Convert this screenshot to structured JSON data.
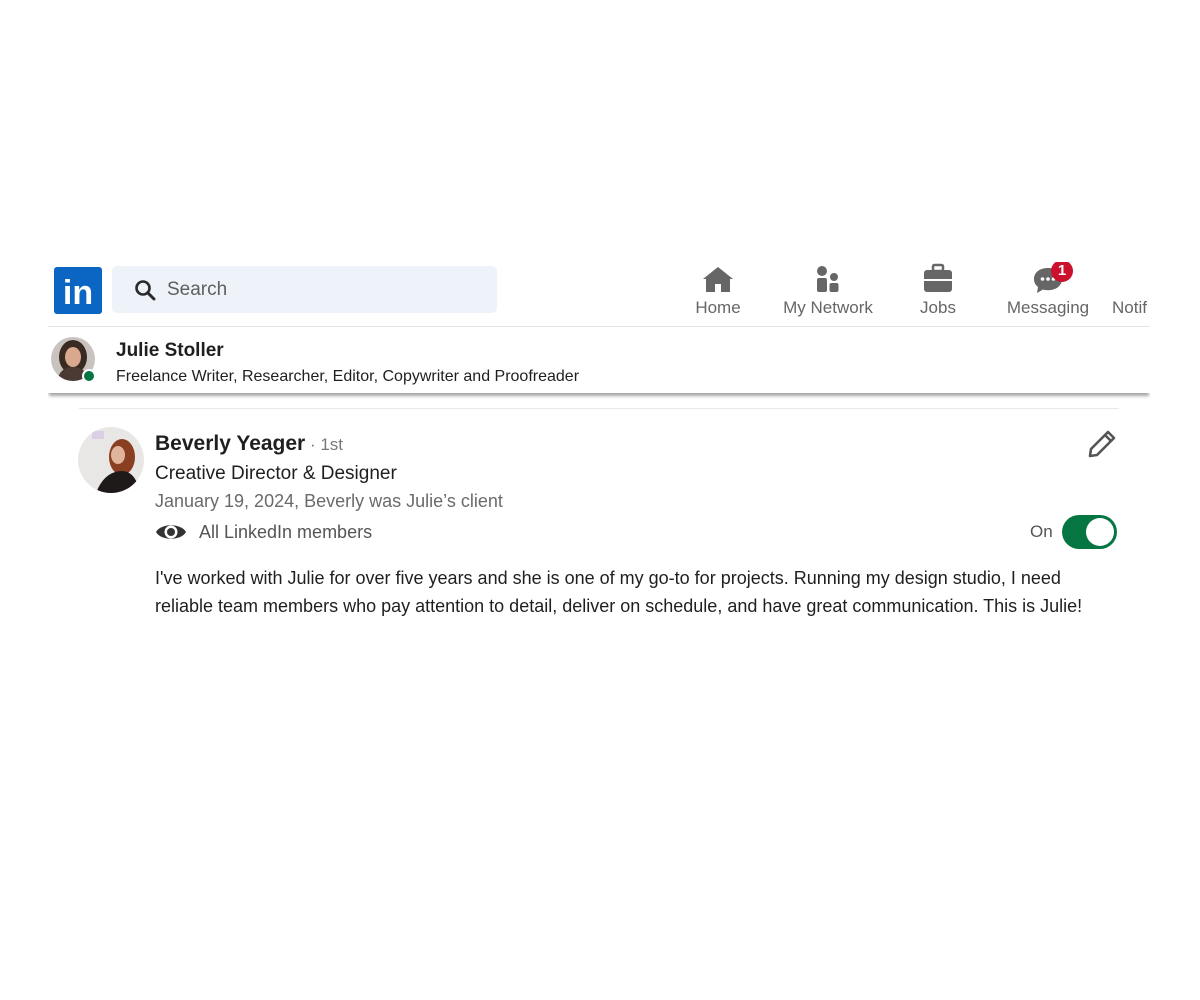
{
  "nav": {
    "logo_text": "in",
    "search_placeholder": "Search",
    "items": [
      {
        "label": "Home",
        "icon": "home-icon"
      },
      {
        "label": "My Network",
        "icon": "network-icon"
      },
      {
        "label": "Jobs",
        "icon": "briefcase-icon"
      },
      {
        "label": "Messaging",
        "icon": "messaging-icon",
        "badge": "1"
      },
      {
        "label": "Notif",
        "icon": "bell-icon"
      }
    ],
    "badge_color": "#cb112d",
    "brand_color": "#0a66c2"
  },
  "profile_bar": {
    "name": "Julie Stoller",
    "headline": "Freelance Writer, Researcher, Editor, Copywriter and Proofreader",
    "online_color": "#057642"
  },
  "recommendation": {
    "name": "Beverly Yeager",
    "degree": " · 1st",
    "title": "Creative Director & Designer",
    "date_relation": "January 19, 2024, Beverly was Julie’s client",
    "visibility": "All LinkedIn members",
    "toggle_label": "On",
    "toggle_on": true,
    "toggle_color": "#057642",
    "text": "I've worked with Julie for over five years and she is one of my go-to for projects. Running my design studio, I need reliable team members who pay attention to detail, deliver on schedule, and have great communication. This is Julie!"
  }
}
